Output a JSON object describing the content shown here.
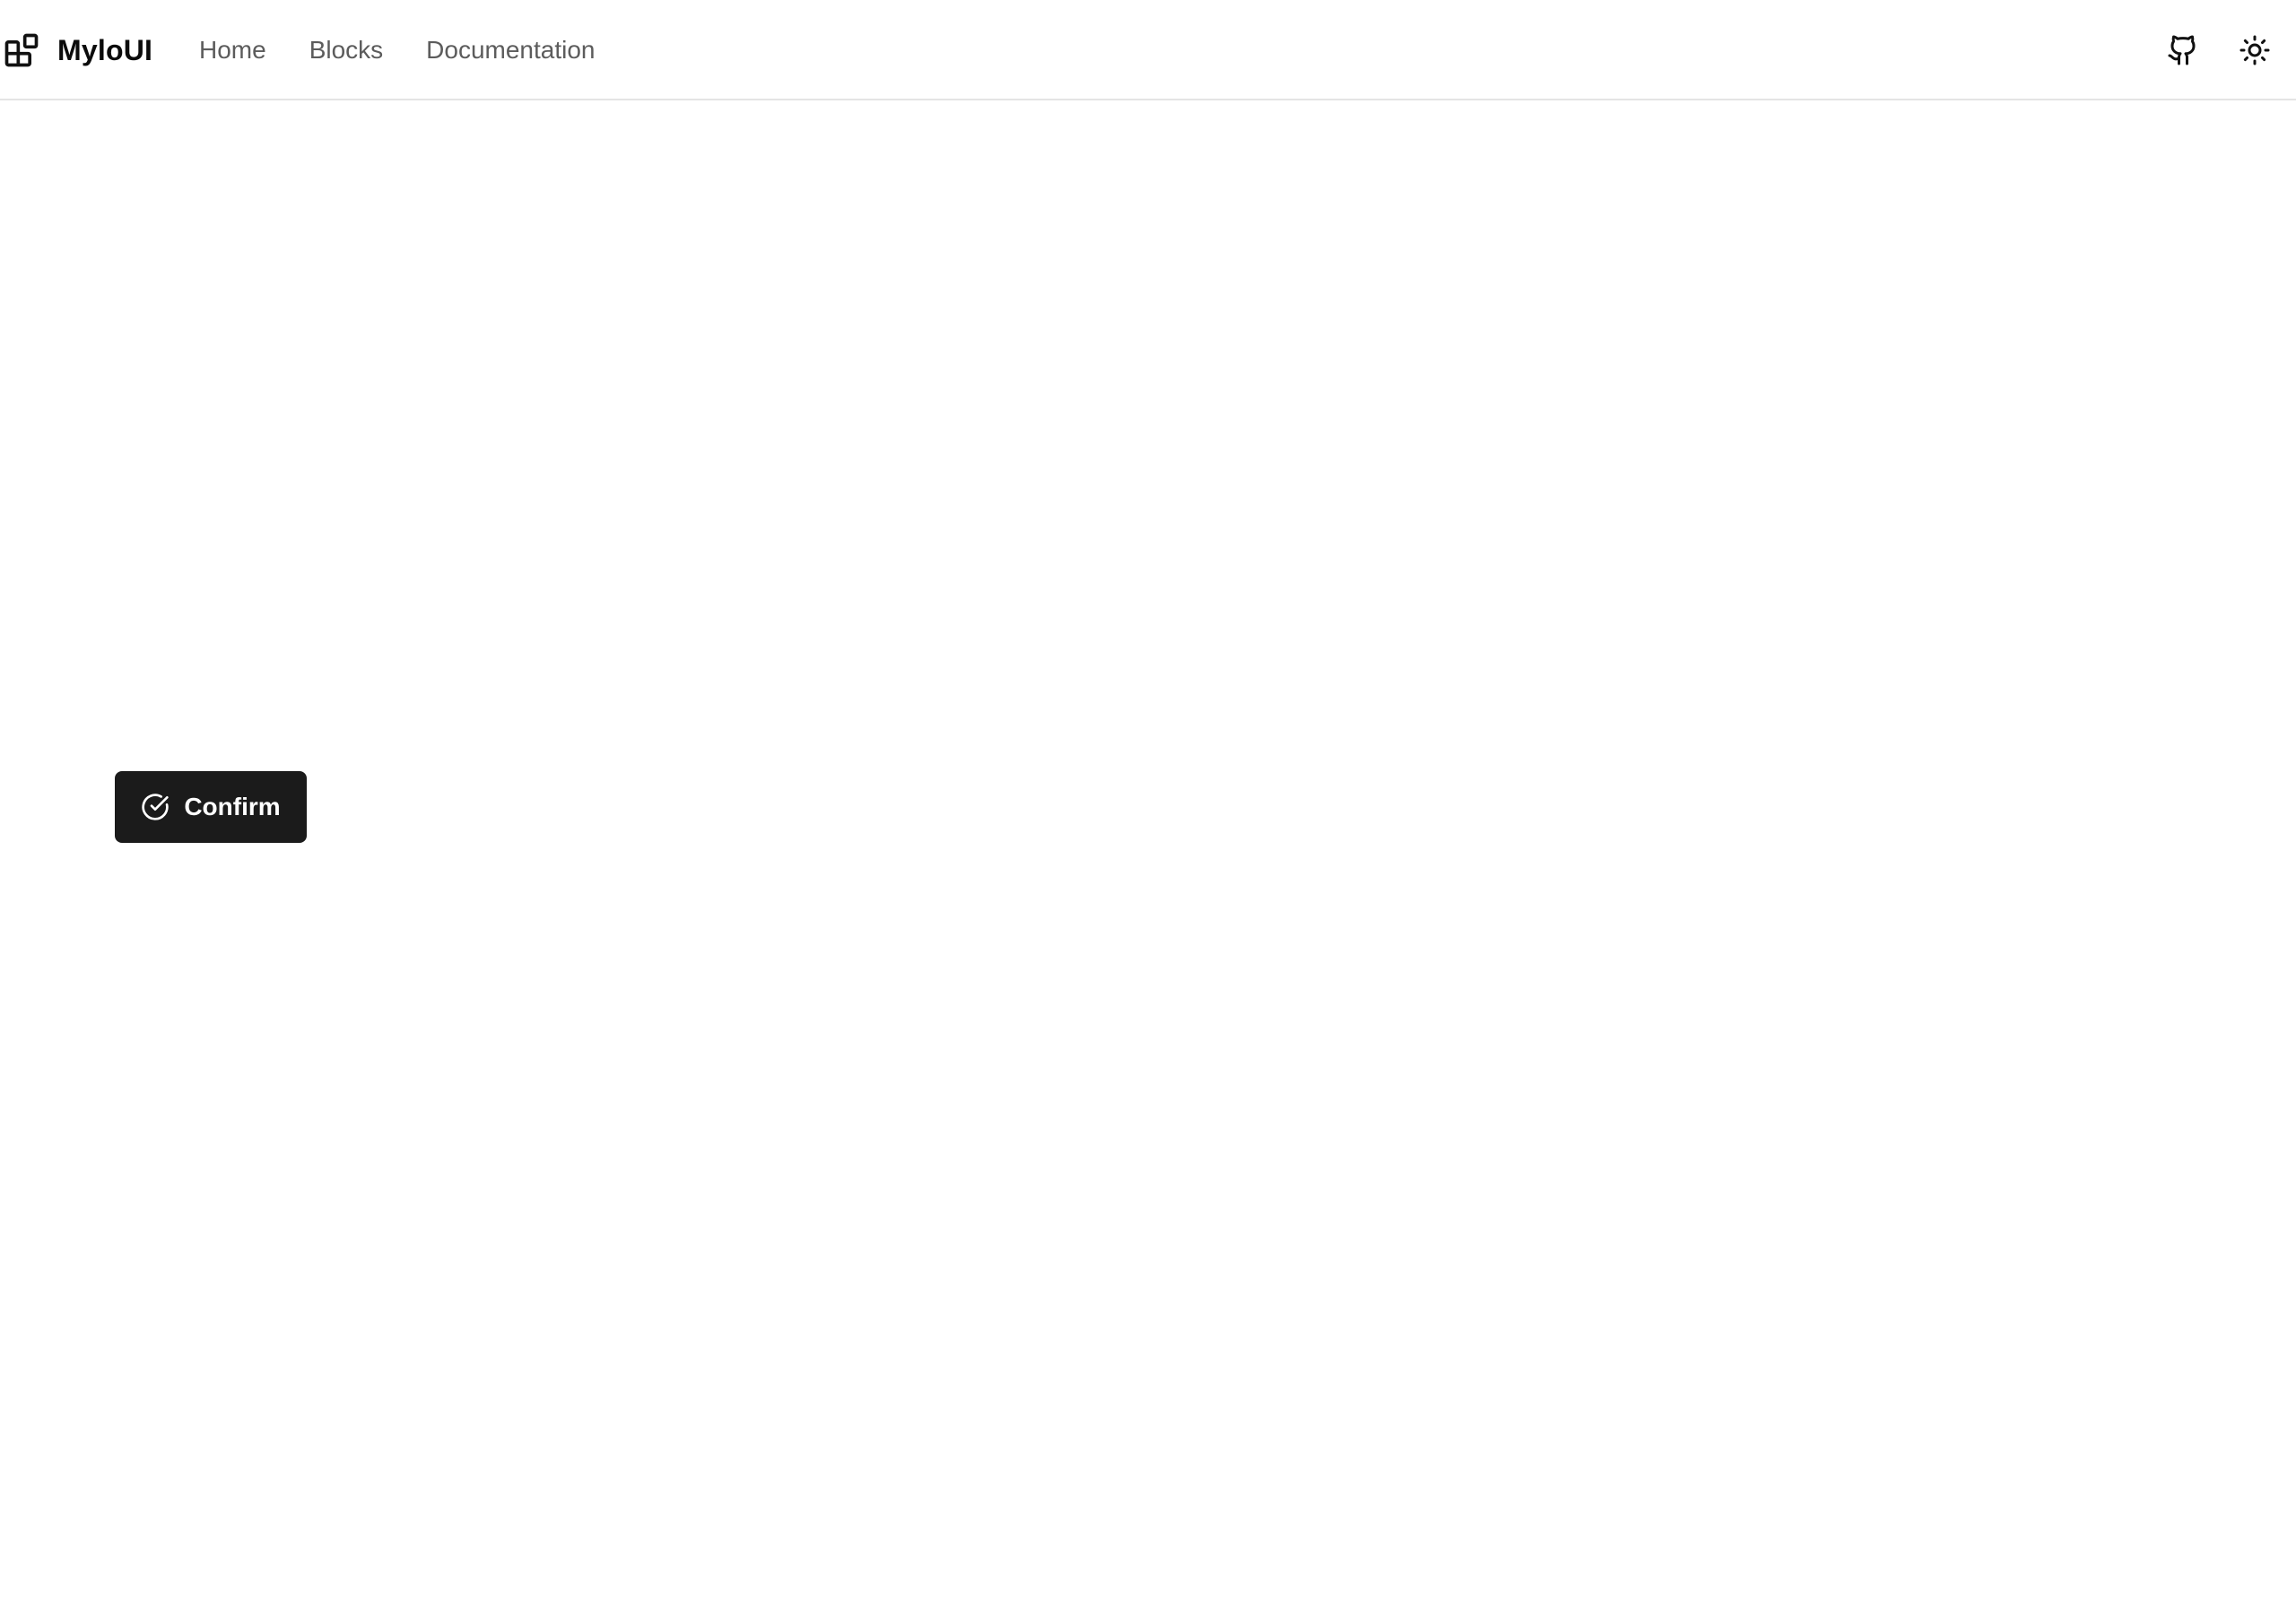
{
  "header": {
    "brand": {
      "name": "MyloUI",
      "icon": "blocks-logo-icon"
    },
    "nav": [
      {
        "label": "Home"
      },
      {
        "label": "Blocks"
      },
      {
        "label": "Documentation"
      }
    ],
    "actions": [
      {
        "icon": "github-icon"
      },
      {
        "icon": "sun-icon"
      }
    ]
  },
  "main": {
    "confirm_button": {
      "label": "Confirm",
      "icon": "check-circle-icon"
    }
  },
  "colors": {
    "button_bg": "#1b1b1b",
    "nav_text": "#5c5c5c",
    "border": "#e4e4e4"
  }
}
